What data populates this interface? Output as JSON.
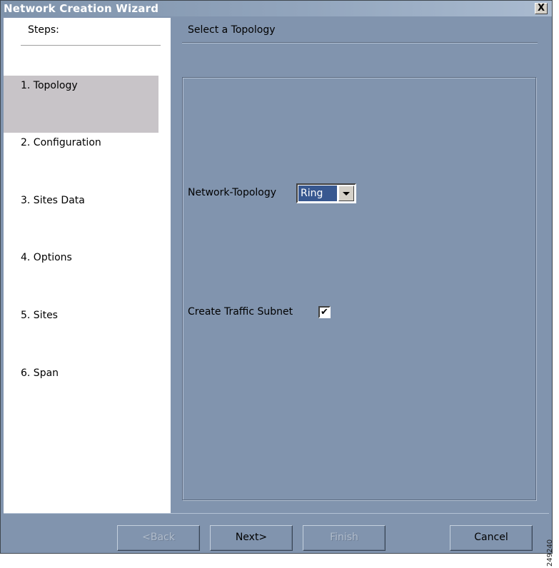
{
  "window": {
    "title": "Network Creation Wizard",
    "close_label": "X"
  },
  "steps": {
    "header": "Steps:",
    "items": [
      {
        "label": "1. Topology",
        "active": true
      },
      {
        "label": "2. Configuration",
        "active": false
      },
      {
        "label": "3. Sites Data",
        "active": false
      },
      {
        "label": "4. Options",
        "active": false
      },
      {
        "label": "5. Sites",
        "active": false
      },
      {
        "label": "6. Span",
        "active": false
      }
    ]
  },
  "main": {
    "title": "Select a Topology",
    "topology_label": "Network-Topology",
    "topology_value": "Ring",
    "traffic_subnet_label": "Create Traffic Subnet",
    "traffic_subnet_checked": true,
    "check_mark": "✔"
  },
  "buttons": {
    "back": "<Back",
    "next": "Next>",
    "finish": "Finish",
    "cancel": "Cancel"
  },
  "side_note": "249240",
  "colors": {
    "window_bg": "#8194ae",
    "selected_step": "#c8c4c8",
    "select_highlight": "#385890"
  }
}
